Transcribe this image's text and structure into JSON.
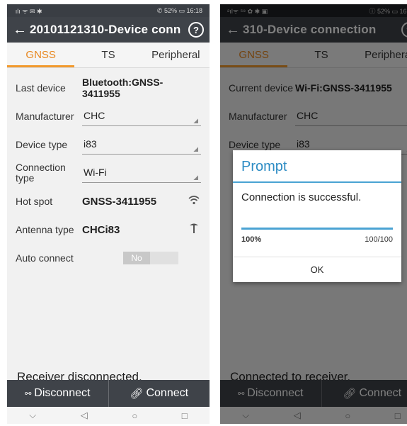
{
  "left": {
    "status": {
      "left": " ılı ᯤ ✉ ✱",
      "right": "✆ 52% ▭ 16:18"
    },
    "title": "20101121310-Device conn",
    "tabs": [
      "GNSS",
      "TS",
      "Peripheral"
    ],
    "fields": {
      "last_device_label": "Last device",
      "last_device_value": "Bluetooth:GNSS-3411955",
      "manufacturer_label": "Manufacturer",
      "manufacturer_value": "CHC",
      "device_type_label": "Device type",
      "device_type_value": "i83",
      "connection_type_label": "Connection type",
      "connection_type_value": "Wi-Fi",
      "hot_spot_label": "Hot spot",
      "hot_spot_value": "GNSS-3411955",
      "antenna_type_label": "Antenna type",
      "antenna_type_value": "CHCi83",
      "auto_connect_label": "Auto connect",
      "auto_connect_value": "No"
    },
    "status_message": "Receiver disconnected.",
    "disconnect_label": "Disconnect",
    "connect_label": "Connect"
  },
  "right": {
    "status": {
      "left": "ᵊılᯤ ⁵⁸ ✿ ✱ ▣",
      "right": "ⓘ 52% ▭ 16:30"
    },
    "title": "310-Device connection",
    "tabs": [
      "GNSS",
      "TS",
      "Peripheral"
    ],
    "fields": {
      "current_device_label": "Current device",
      "current_device_value": "Wi-Fi:GNSS-3411955",
      "manufacturer_label": "Manufacturer",
      "manufacturer_value": "CHC",
      "device_type_label": "Device type",
      "device_type_value": "i83"
    },
    "status_message": "Connected to receiver.",
    "disconnect_label": "Disconnect",
    "connect_label": "Connect",
    "dialog": {
      "title": "Prompt",
      "message": "Connection is successful.",
      "percent": "100%",
      "count": "100/100",
      "progress": 1.0,
      "ok_label": "OK"
    }
  },
  "nav": {
    "back": "◁",
    "home": "○",
    "recent": "□",
    "down": "⌵"
  },
  "colors": {
    "accent": "#f29a2e",
    "appbar": "#3f4349",
    "dialog_blue": "#4aa3d3"
  }
}
